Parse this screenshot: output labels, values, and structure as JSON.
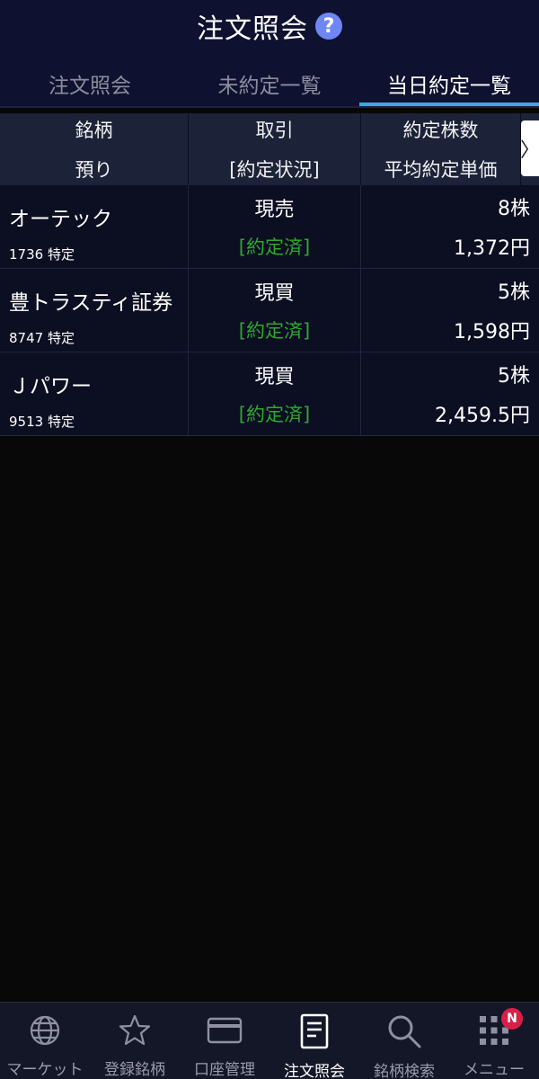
{
  "header": {
    "title": "注文照会",
    "help_icon": "?",
    "tabs": [
      {
        "label": "注文照会",
        "active": false
      },
      {
        "label": "未約定一覧",
        "active": false
      },
      {
        "label": "当日約定一覧",
        "active": true
      }
    ]
  },
  "table": {
    "columns": {
      "c1_line1": "銘柄",
      "c1_line2": "預り",
      "c2_line1": "取引",
      "c2_line2": "[約定状況]",
      "c3_line1": "約定株数",
      "c3_line2": "平均約定単価",
      "more": "〉"
    },
    "rows": [
      {
        "name": "オーテック",
        "code_account": "1736 特定",
        "trade": "現売",
        "status": "[約定済]",
        "qty": "8株",
        "price": "1,372円"
      },
      {
        "name": "豊トラスティ証券",
        "code_account": "8747 特定",
        "trade": "現買",
        "status": "[約定済]",
        "qty": "5株",
        "price": "1,598円"
      },
      {
        "name": "Ｊパワー",
        "code_account": "9513 特定",
        "trade": "現買",
        "status": "[約定済]",
        "qty": "5株",
        "price": "2,459.5円"
      }
    ]
  },
  "bottom_nav": {
    "items": [
      {
        "label": "マーケット",
        "icon": "globe-icon",
        "active": false
      },
      {
        "label": "登録銘柄",
        "icon": "star-icon",
        "active": false
      },
      {
        "label": "口座管理",
        "icon": "card-icon",
        "active": false
      },
      {
        "label": "注文照会",
        "icon": "document-icon",
        "active": true
      },
      {
        "label": "銘柄検索",
        "icon": "search-icon",
        "active": false
      },
      {
        "label": "メニュー",
        "icon": "grid-menu-icon",
        "active": false,
        "badge": "N"
      }
    ]
  },
  "colors": {
    "header_bg": "#0f1130",
    "tab_underline": "#3ea6e0",
    "status_green": "#2ea82e",
    "badge_red": "#d81f48"
  }
}
